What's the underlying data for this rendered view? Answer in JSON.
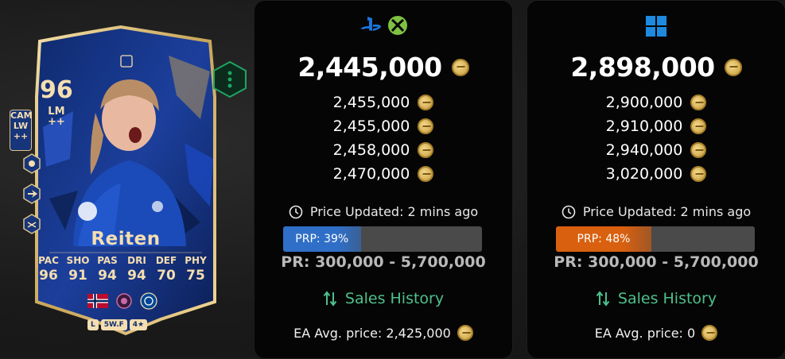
{
  "card": {
    "rating": "96",
    "positions": [
      "CAM",
      "LW",
      "++"
    ],
    "alt_position": "LM",
    "alt_position_extra": "++",
    "name": "Reiten",
    "stats": [
      {
        "label": "PAC",
        "value": "96"
      },
      {
        "label": "SHO",
        "value": "91"
      },
      {
        "label": "PAS",
        "value": "94"
      },
      {
        "label": "DRI",
        "value": "94"
      },
      {
        "label": "DEF",
        "value": "70"
      },
      {
        "label": "PHY",
        "value": "75"
      }
    ],
    "foot": "L",
    "weak_foot": "5W.F",
    "skill_moves": "4★",
    "colors": {
      "card_bg": "#17357a",
      "gold": "#f5deb0",
      "accent_green": "#1fa463"
    }
  },
  "console_panel": {
    "platform_icons": [
      "playstation-icon",
      "xbox-icon"
    ],
    "main_price": "2,445,000",
    "prices": [
      "2,455,000",
      "2,455,000",
      "2,458,000",
      "2,470,000"
    ],
    "updated": "Price Updated: 2 mins ago",
    "prp_label": "PRP: 39%",
    "prp_value": 39,
    "prp_color": "#2f6fc7",
    "pr_range": "PR: 300,000 - 5,700,000",
    "sales_history": "Sales History",
    "ea_avg": "EA Avg. price: 2,425,000"
  },
  "pc_panel": {
    "platform_icons": [
      "windows-icon"
    ],
    "main_price": "2,898,000",
    "prices": [
      "2,900,000",
      "2,910,000",
      "2,940,000",
      "3,020,000"
    ],
    "updated": "Price Updated: 2 mins ago",
    "prp_label": "PRP: 48%",
    "prp_value": 48,
    "prp_color": "#d9600f",
    "pr_range": "PR: 300,000 - 5,700,000",
    "sales_history": "Sales History",
    "ea_avg": "EA Avg. price: 0"
  }
}
